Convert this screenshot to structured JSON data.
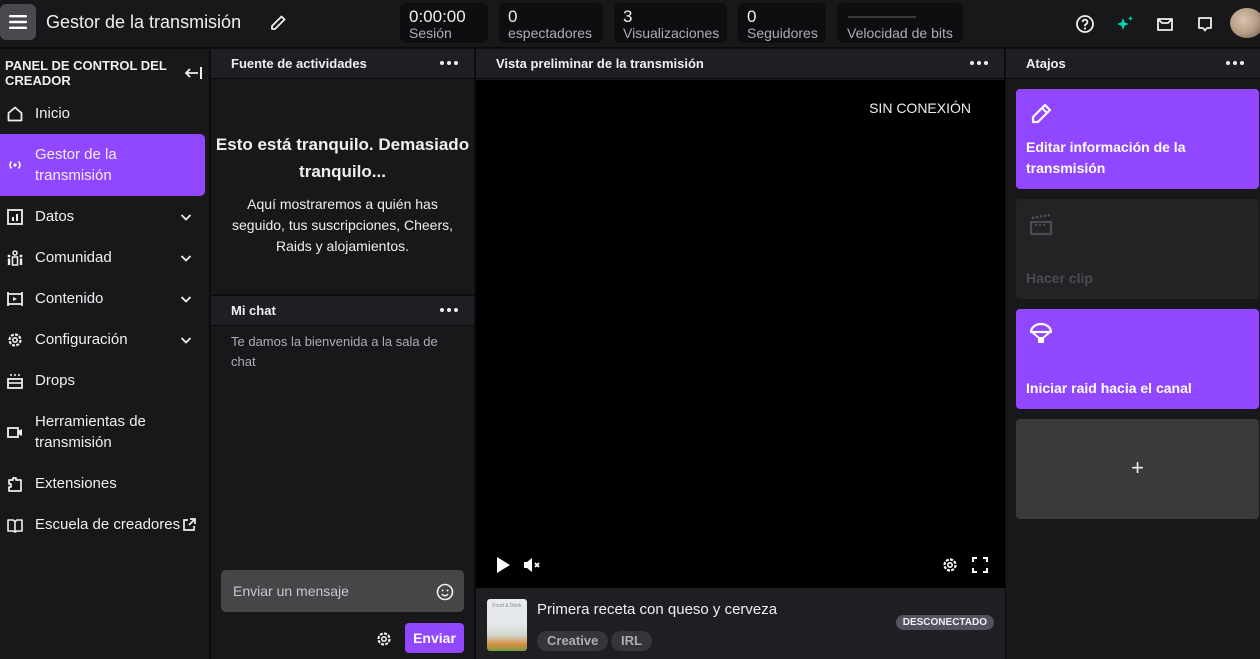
{
  "header": {
    "title": "Gestor de la transmisión",
    "stats": [
      {
        "value": "0:00:00",
        "label": "Sesión"
      },
      {
        "value": "0",
        "label": "espectadores"
      },
      {
        "value": "3",
        "label": "Visualizaciones"
      },
      {
        "value": "0",
        "label": "Seguidores"
      },
      {
        "value": "",
        "label": "Velocidad de bits"
      }
    ],
    "icons": [
      "help-icon",
      "sparkle-icon",
      "inbox-icon",
      "whispers-icon",
      "avatar"
    ],
    "accent_color": "#00d6b4"
  },
  "sidebar": {
    "title": "PANEL DE CONTROL DEL CREADOR",
    "items": [
      {
        "label": "Inicio",
        "icon": "home-icon",
        "expandable": false,
        "active": false
      },
      {
        "label": "Gestor de la transmisión",
        "icon": "broadcast-icon",
        "expandable": false,
        "active": true
      },
      {
        "label": "Datos",
        "icon": "analytics-icon",
        "expandable": true,
        "active": false
      },
      {
        "label": "Comunidad",
        "icon": "community-icon",
        "expandable": true,
        "active": false
      },
      {
        "label": "Contenido",
        "icon": "content-icon",
        "expandable": true,
        "active": false
      },
      {
        "label": "Configuración",
        "icon": "settings-icon",
        "expandable": true,
        "active": false
      },
      {
        "label": "Drops",
        "icon": "drops-icon",
        "expandable": false,
        "active": false
      },
      {
        "label": "Herramientas de transmisión",
        "icon": "camera-icon",
        "expandable": false,
        "active": false
      },
      {
        "label": "Extensiones",
        "icon": "extensions-icon",
        "expandable": false,
        "active": false
      },
      {
        "label": "Escuela de creadores",
        "icon": "book-icon",
        "expandable": false,
        "active": false,
        "external": true
      }
    ],
    "active_color": "#9147ff"
  },
  "activity_feed": {
    "title": "Fuente de actividades",
    "empty_title": "Esto está tranquilo. Demasiado tranquilo...",
    "empty_body": "Aquí mostraremos a quién has seguido, tus suscripciones, Cheers, Raids y alojamientos."
  },
  "chat": {
    "title": "Mi chat",
    "welcome": "Te damos la bienvenida a la sala de chat",
    "input_placeholder": "Enviar un mensaje",
    "send_label": "Enviar"
  },
  "preview": {
    "title": "Vista preliminar de la transmisión",
    "offline_label": "SIN CONEXIÓN",
    "stream_title": "Primera receta con queso y cerveza",
    "thumbnail_text": "Food & Drink",
    "tags": [
      "Creative",
      "IRL"
    ],
    "status": "DESCONECTADO"
  },
  "shortcuts": {
    "title": "Atajos",
    "cards": [
      {
        "label": "Editar información de la transmisión",
        "icon": "pencil-icon",
        "state": "enabled"
      },
      {
        "label": "Hacer clip",
        "icon": "clapperboard-icon",
        "state": "disabled"
      },
      {
        "label": "Iniciar raid hacia el canal",
        "icon": "raid-icon",
        "state": "enabled"
      },
      {
        "label": "+",
        "icon": "plus-icon",
        "state": "add"
      }
    ]
  }
}
